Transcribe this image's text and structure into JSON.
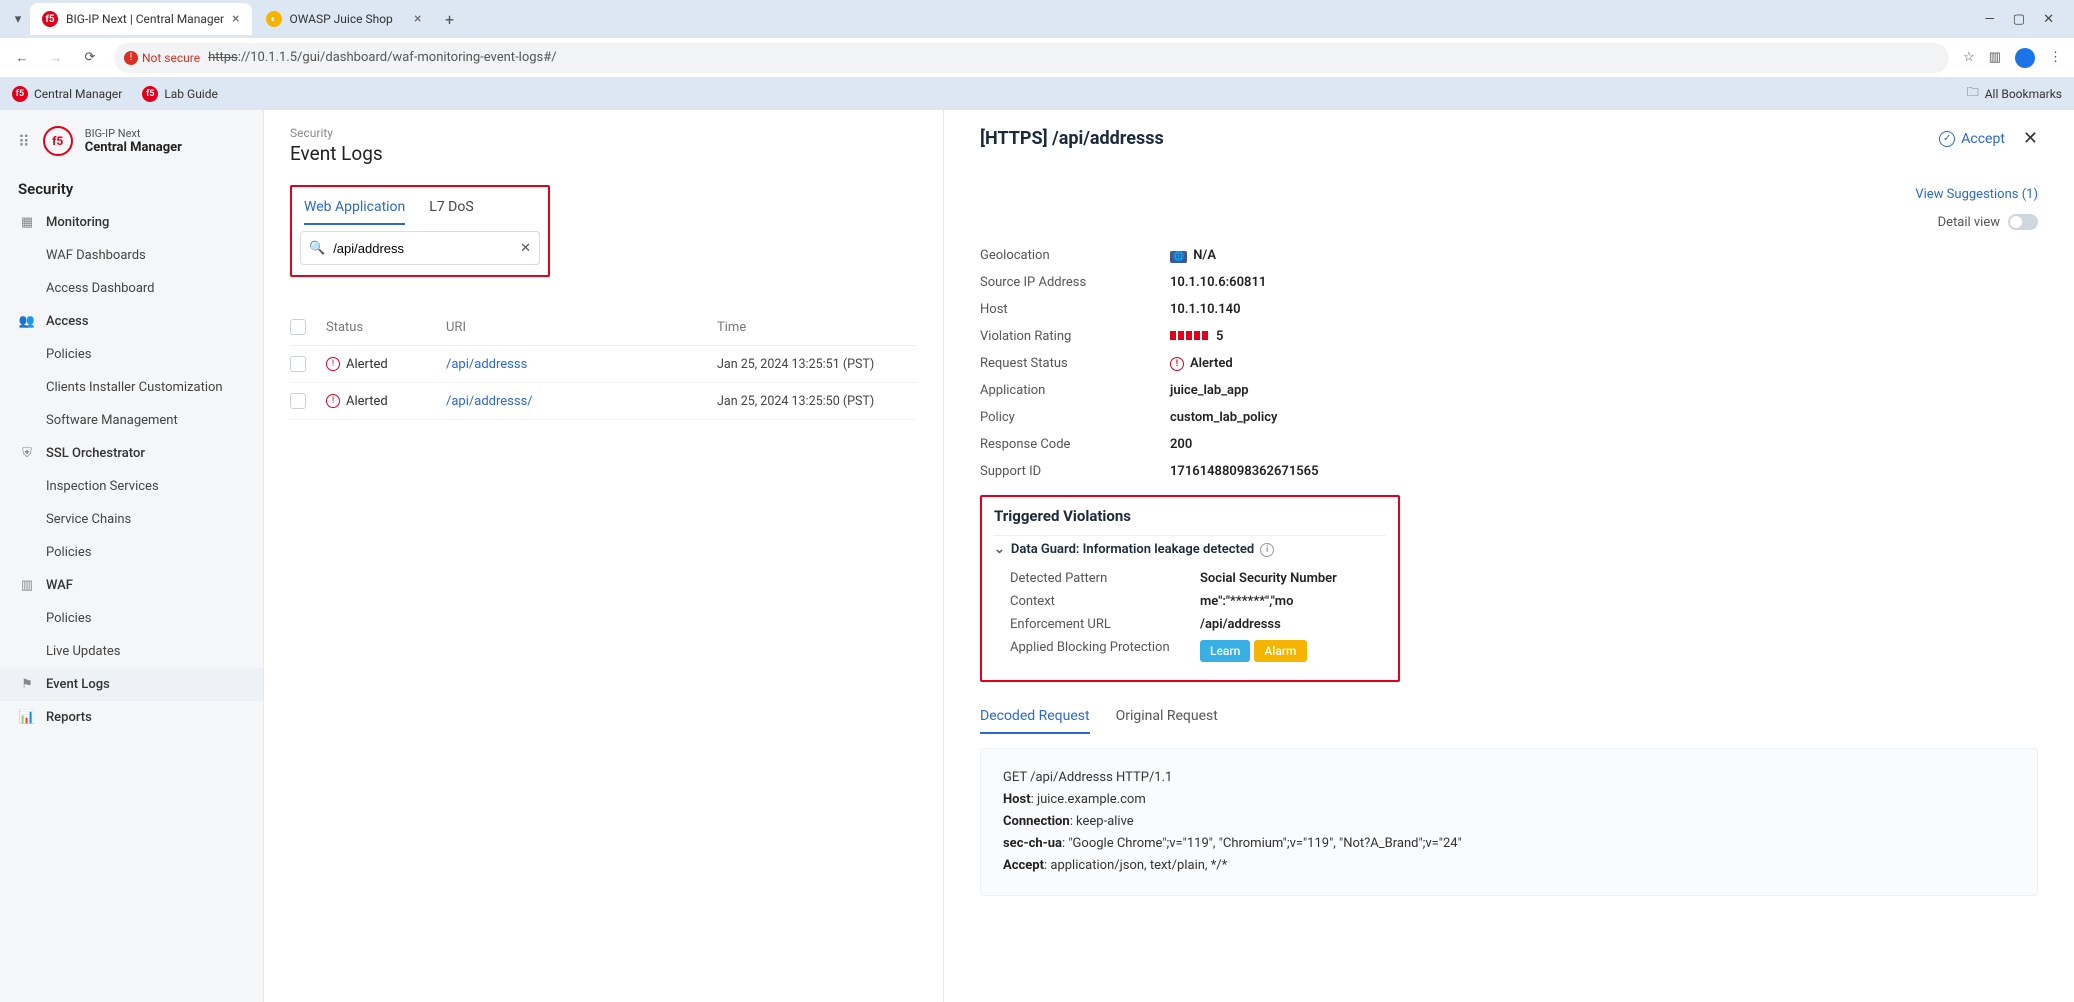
{
  "browser": {
    "tabs": [
      {
        "title": "BIG-IP Next | Central Manager",
        "active": true,
        "favicon": "f5"
      },
      {
        "title": "OWASP Juice Shop",
        "active": false,
        "favicon": "juice"
      }
    ],
    "not_secure": "Not secure",
    "url_scheme": "https",
    "url_rest": "://10.1.1.5/gui/dashboard/waf-monitoring-event-logs#/",
    "bookmarks": [
      {
        "label": "Central Manager"
      },
      {
        "label": "Lab Guide"
      }
    ],
    "all_bookmarks": "All Bookmarks"
  },
  "sidebar": {
    "product_line1": "BIG-IP Next",
    "product_line2": "Central Manager",
    "section_title": "Security",
    "items": [
      {
        "label": "Monitoring",
        "icon": "grid"
      },
      {
        "label": "WAF Dashboards",
        "sub": true
      },
      {
        "label": "Access Dashboard",
        "sub": true
      },
      {
        "label": "Access",
        "icon": "users"
      },
      {
        "label": "Policies",
        "sub": true
      },
      {
        "label": "Clients Installer Customization",
        "sub": true
      },
      {
        "label": "Software Management",
        "sub": true
      },
      {
        "label": "SSL Orchestrator",
        "icon": "shield"
      },
      {
        "label": "Inspection Services",
        "sub": true
      },
      {
        "label": "Service Chains",
        "sub": true
      },
      {
        "label": "Policies",
        "sub": true
      },
      {
        "label": "WAF",
        "icon": "bars"
      },
      {
        "label": "Policies",
        "sub": true
      },
      {
        "label": "Live Updates",
        "sub": true
      },
      {
        "label": "Event Logs",
        "icon": "flag",
        "active": true
      },
      {
        "label": "Reports",
        "icon": "chart"
      }
    ]
  },
  "list": {
    "breadcrumb": "Security",
    "title": "Event Logs",
    "subtabs": {
      "web": "Web Application",
      "l7": "L7 DoS"
    },
    "search_value": "/api/address",
    "columns": {
      "status": "Status",
      "uri": "URI",
      "time": "Time"
    },
    "rows": [
      {
        "status": "Alerted",
        "uri": "/api/addresss",
        "time": "Jan 25, 2024 13:25:51 (PST)"
      },
      {
        "status": "Alerted",
        "uri": "/api/addresss/",
        "time": "Jan 25, 2024 13:25:50 (PST)"
      }
    ]
  },
  "detail": {
    "title": "[HTTPS] /api/addresss",
    "accept": "Accept",
    "view_suggestions": "View Suggestions (1)",
    "detail_view": "Detail view",
    "kv": {
      "geolocation": {
        "k": "Geolocation",
        "v": "N/A"
      },
      "source_ip": {
        "k": "Source IP Address",
        "v": "10.1.10.6:60811"
      },
      "host": {
        "k": "Host",
        "v": "10.1.10.140"
      },
      "violation_rating": {
        "k": "Violation Rating",
        "v": "5"
      },
      "request_status": {
        "k": "Request Status",
        "v": "Alerted"
      },
      "application": {
        "k": "Application",
        "v": "juice_lab_app"
      },
      "policy": {
        "k": "Policy",
        "v": "custom_lab_policy"
      },
      "response_code": {
        "k": "Response Code",
        "v": "200"
      },
      "support_id": {
        "k": "Support ID",
        "v": "17161488098362671565"
      }
    },
    "viol": {
      "title": "Triggered Violations",
      "sub": "Data Guard: Information leakage detected",
      "rows": {
        "pattern": {
          "k": "Detected Pattern",
          "v": "Social Security Number"
        },
        "context": {
          "k": "Context",
          "v": "me\":\"******\",\"mo"
        },
        "enforcement": {
          "k": "Enforcement URL",
          "v": "/api/addresss"
        },
        "applied": {
          "k": "Applied Blocking Protection"
        }
      },
      "badge_learn": "Learn",
      "badge_alarm": "Alarm"
    },
    "req_tabs": {
      "decoded": "Decoded Request",
      "original": "Original Request"
    },
    "request": {
      "line1": "GET /api/Addresss HTTP/1.1",
      "host_k": "Host",
      "host_v": ": juice.example.com",
      "conn_k": "Connection",
      "conn_v": ": keep-alive",
      "ua_k": "sec-ch-ua",
      "ua_v": ": \"Google Chrome\";v=\"119\", \"Chromium\";v=\"119\", \"Not?A_Brand\";v=\"24\"",
      "accept_k": "Accept",
      "accept_v": ": application/json, text/plain, */*"
    }
  }
}
